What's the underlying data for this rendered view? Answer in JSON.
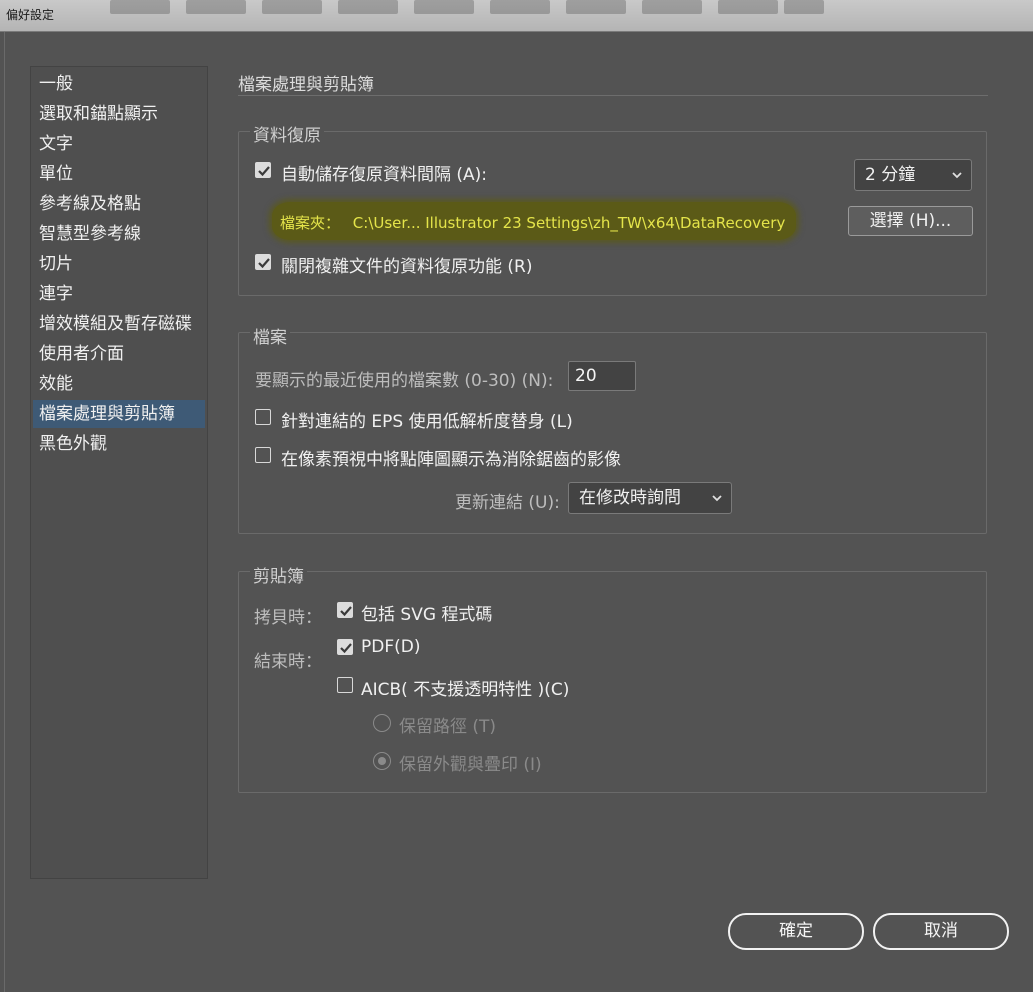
{
  "window": {
    "title": "偏好設定"
  },
  "sidebar": {
    "items": [
      {
        "label": "一般"
      },
      {
        "label": "選取和錨點顯示"
      },
      {
        "label": "文字"
      },
      {
        "label": "單位"
      },
      {
        "label": "參考線及格點"
      },
      {
        "label": "智慧型參考線"
      },
      {
        "label": "切片"
      },
      {
        "label": "連字"
      },
      {
        "label": "增效模組及暫存磁碟"
      },
      {
        "label": "使用者介面"
      },
      {
        "label": "效能"
      },
      {
        "label": "檔案處理與剪貼簿",
        "selected": true
      },
      {
        "label": "黑色外觀"
      }
    ]
  },
  "page": {
    "title": "檔案處理與剪貼簿"
  },
  "recovery": {
    "group_label": "資料復原",
    "autosave_label": "自動儲存復原資料間隔 (A):",
    "autosave_checked": true,
    "interval_value": "2 分鐘",
    "folder_label": "檔案夾：",
    "folder_path": "C:\\User... Illustrator 23 Settings\\zh_TW\\x64\\DataRecovery",
    "choose_button": "選擇 (H)...",
    "complex_label": "關閉複雜文件的資料復原功能 (R)",
    "complex_checked": true
  },
  "files": {
    "group_label": "檔案",
    "recent_label": "要顯示的最近使用的檔案數 (0-30) (N):",
    "recent_value": "20",
    "eps_label": "針對連結的 EPS 使用低解析度替身 (L)",
    "eps_checked": false,
    "pixel_label": "在像素預視中將點陣圖顯示為消除鋸齒的影像",
    "pixel_checked": false,
    "update_label": "更新連結 (U):",
    "update_value": "在修改時詢問"
  },
  "clipboard": {
    "group_label": "剪貼簿",
    "copy_label": "拷貝時：",
    "svg_label": "包括 SVG 程式碼",
    "svg_checked": true,
    "quit_label": "結束時：",
    "pdf_label": "PDF(D)",
    "pdf_checked": true,
    "aicb_label": "AICB( 不支援透明特性 )(C)",
    "aicb_checked": false,
    "radio_paths_label": "保留路徑 (T)",
    "radio_appearance_label": "保留外觀與疊印 (I)"
  },
  "footer": {
    "ok_label": "確定",
    "cancel_label": "取消"
  },
  "colors": {
    "background": "#535353",
    "selection": "#3e5a76",
    "highlight": "#5b5a17",
    "path_text": "#e4e44a"
  }
}
